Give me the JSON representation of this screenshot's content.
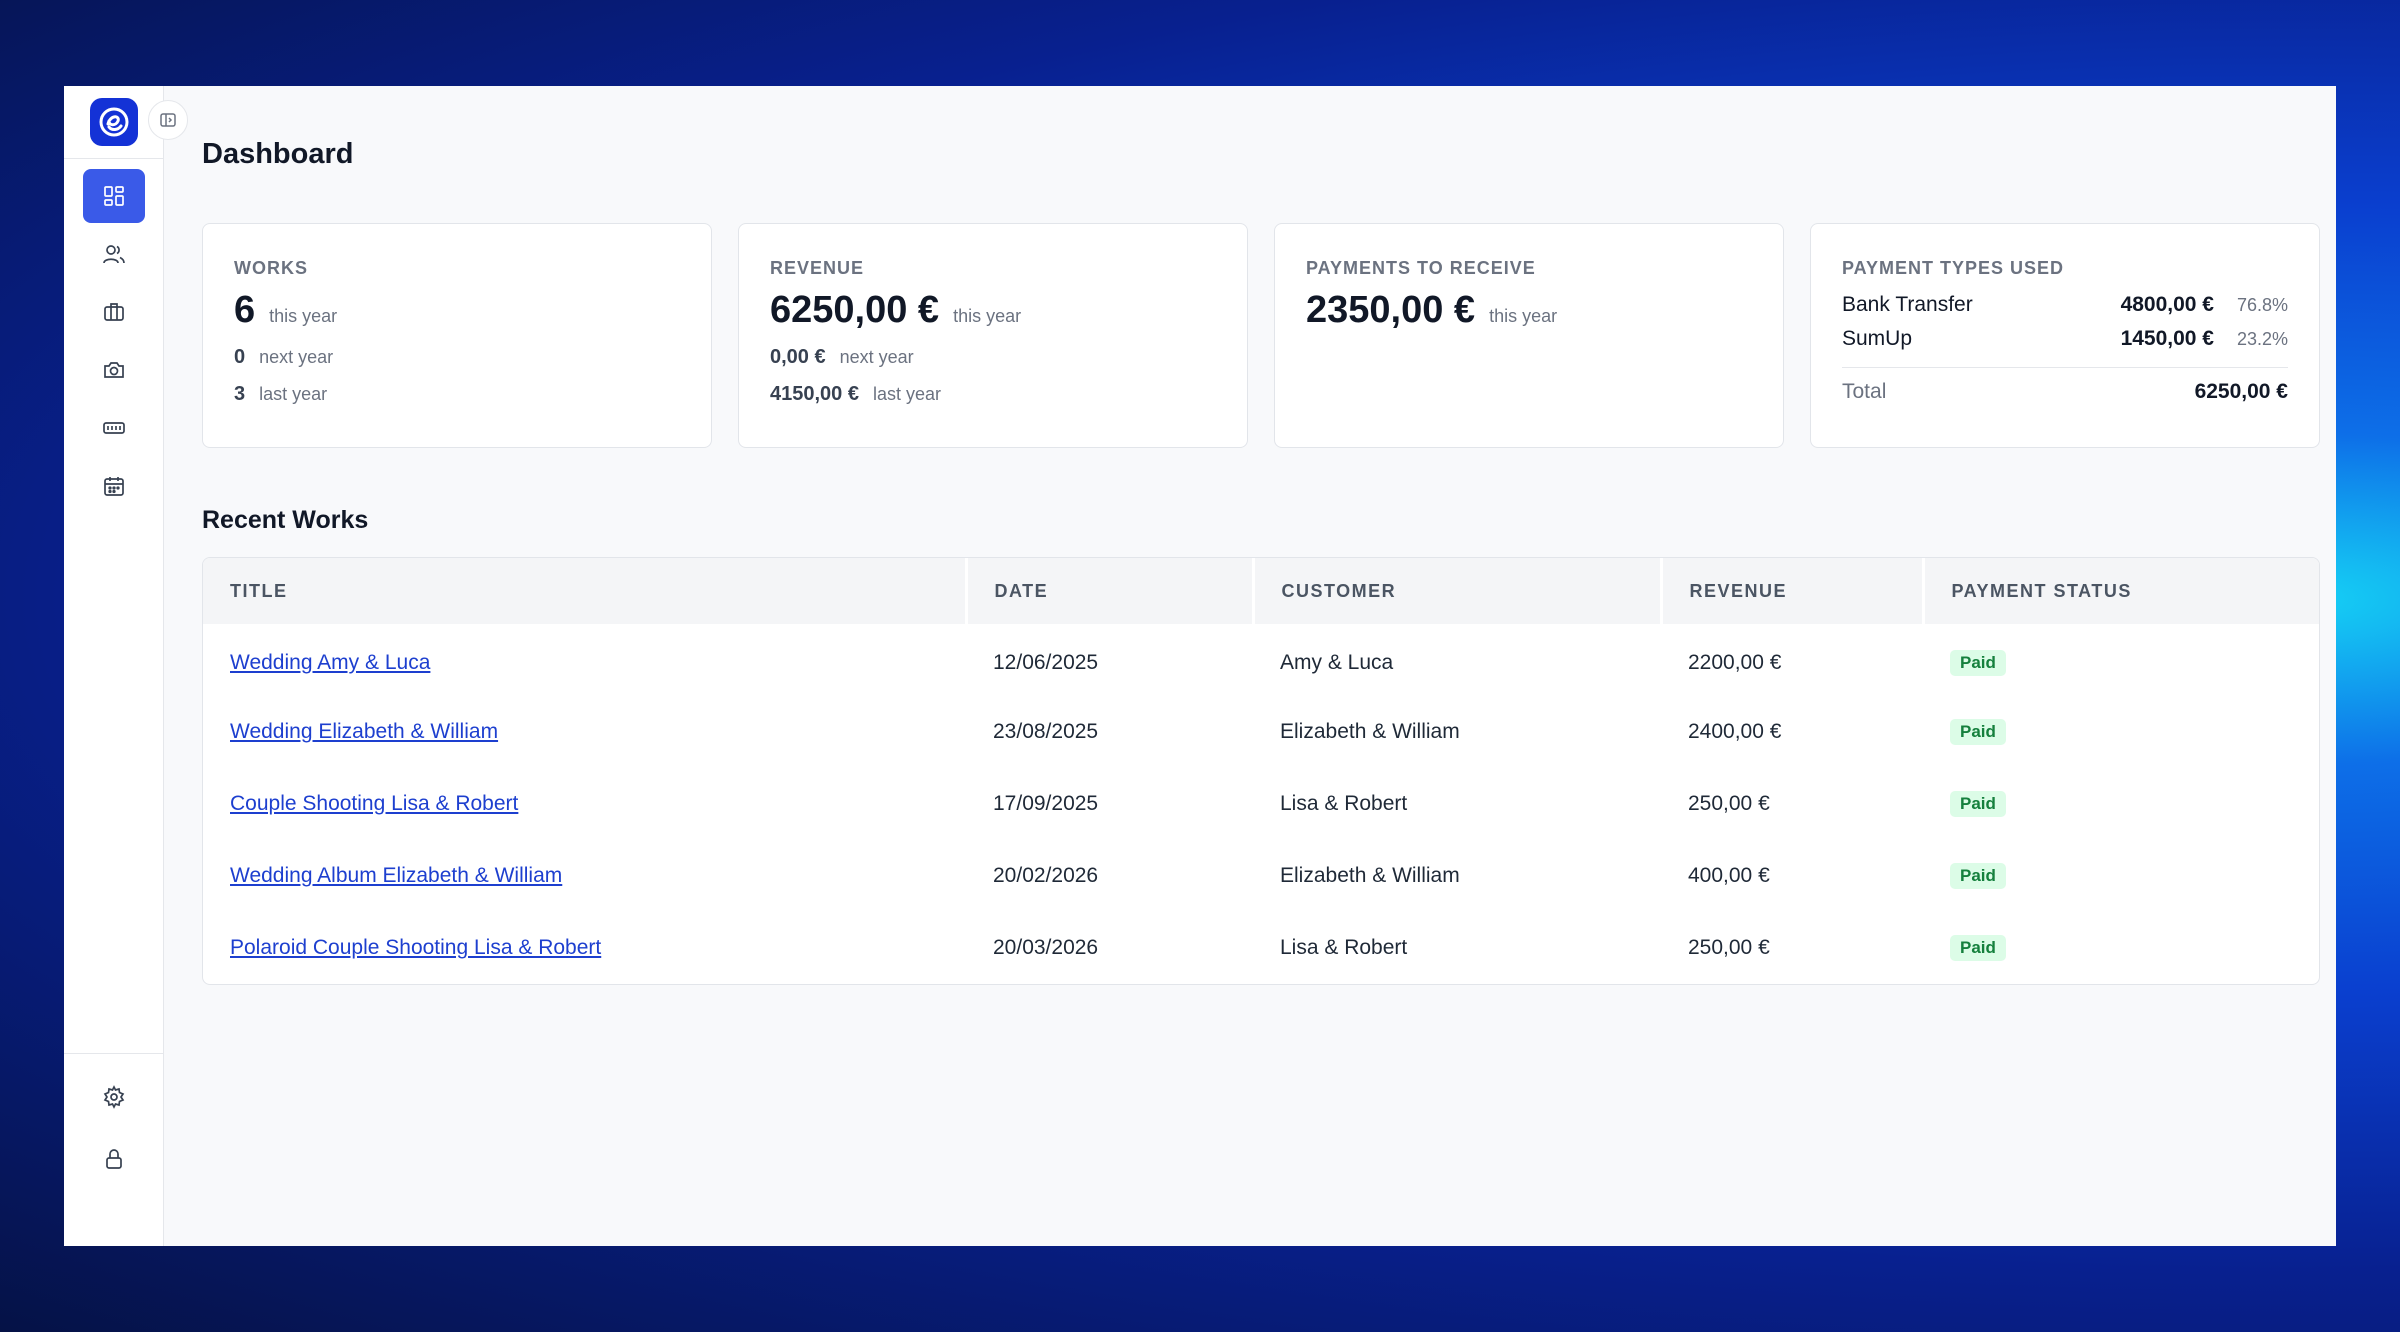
{
  "page": {
    "title": "Dashboard"
  },
  "sidebar": {
    "logo_icon": "logo-e-icon",
    "items": [
      {
        "icon": "dashboard-icon",
        "active": true
      },
      {
        "icon": "users-icon"
      },
      {
        "icon": "briefcase-icon"
      },
      {
        "icon": "camera-icon"
      },
      {
        "icon": "ticket-icon"
      },
      {
        "icon": "calendar-icon"
      }
    ],
    "bottom_items": [
      {
        "icon": "gear-icon"
      },
      {
        "icon": "lock-icon"
      }
    ]
  },
  "cards": {
    "works": {
      "label": "WORKS",
      "this_year_value": "6",
      "this_year_label": "this year",
      "next_year_value": "0",
      "next_year_label": "next year",
      "last_year_value": "3",
      "last_year_label": "last year"
    },
    "revenue": {
      "label": "REVENUE",
      "this_year_value": "6250,00 €",
      "this_year_label": "this year",
      "next_year_value": "0,00 €",
      "next_year_label": "next year",
      "last_year_value": "4150,00 €",
      "last_year_label": "last year"
    },
    "payments": {
      "label": "PAYMENTS TO RECEIVE",
      "this_year_value": "2350,00 €",
      "this_year_label": "this year"
    },
    "payment_types": {
      "label": "PAYMENT TYPES USED",
      "rows": [
        {
          "name": "Bank Transfer",
          "amount": "4800,00 €",
          "percent": "76.8%"
        },
        {
          "name": "SumUp",
          "amount": "1450,00 €",
          "percent": "23.2%"
        }
      ],
      "total_label": "Total",
      "total_amount": "6250,00 €"
    }
  },
  "recent_works": {
    "title": "Recent Works",
    "columns": [
      "TITLE",
      "DATE",
      "CUSTOMER",
      "REVENUE",
      "PAYMENT STATUS"
    ],
    "rows": [
      {
        "title": "Wedding Amy & Luca",
        "date": "12/06/2025",
        "customer": "Amy & Luca",
        "revenue": "2200,00 €",
        "status": "Paid"
      },
      {
        "title": "Wedding Elizabeth & William",
        "date": "23/08/2025",
        "customer": "Elizabeth & William",
        "revenue": "2400,00 €",
        "status": "Paid"
      },
      {
        "title": "Couple Shooting Lisa & Robert",
        "date": "17/09/2025",
        "customer": "Lisa & Robert",
        "revenue": "250,00 €",
        "status": "Paid"
      },
      {
        "title": "Wedding Album Elizabeth & William",
        "date": "20/02/2026",
        "customer": "Elizabeth & William",
        "revenue": "400,00 €",
        "status": "Paid"
      },
      {
        "title": "Polaroid Couple Shooting Lisa & Robert",
        "date": "20/03/2026",
        "customer": "Lisa & Robert",
        "revenue": "250,00 €",
        "status": "Paid"
      }
    ]
  },
  "colors": {
    "accent": "#3a5ae8",
    "logo": "#1432d6",
    "link": "#1d3fcf",
    "paid_bg": "#dcfce7",
    "paid_text": "#15803d"
  }
}
